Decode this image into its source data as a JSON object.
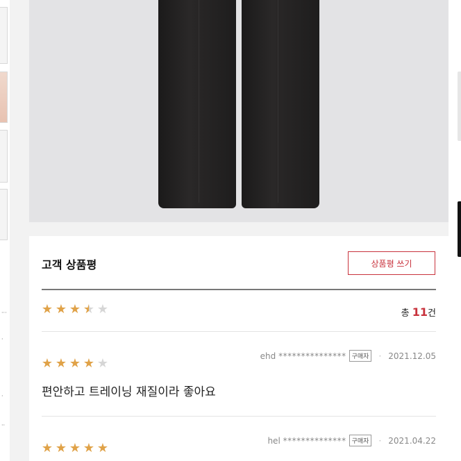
{
  "review_section": {
    "title": "고객 상품평",
    "write_button": "상품평 쓰기",
    "average_rating": 3.5,
    "total_prefix": "총",
    "total_count": "11",
    "total_suffix": "건"
  },
  "reviews": [
    {
      "user": "ehd",
      "masked": "***************",
      "badge": "구매자",
      "date": "2021.12.05",
      "rating": 4,
      "text": "편안하고 트레이닝 재질이라 좋아요"
    },
    {
      "user": "hel",
      "masked": "**************",
      "badge": "구매자",
      "date": "2021.04.22",
      "rating": 5,
      "text": ""
    }
  ],
  "icons": {
    "star": "star-icon"
  },
  "colors": {
    "accent": "#c8323c",
    "star": "#e0a248",
    "star_empty": "#d6d6d6"
  }
}
